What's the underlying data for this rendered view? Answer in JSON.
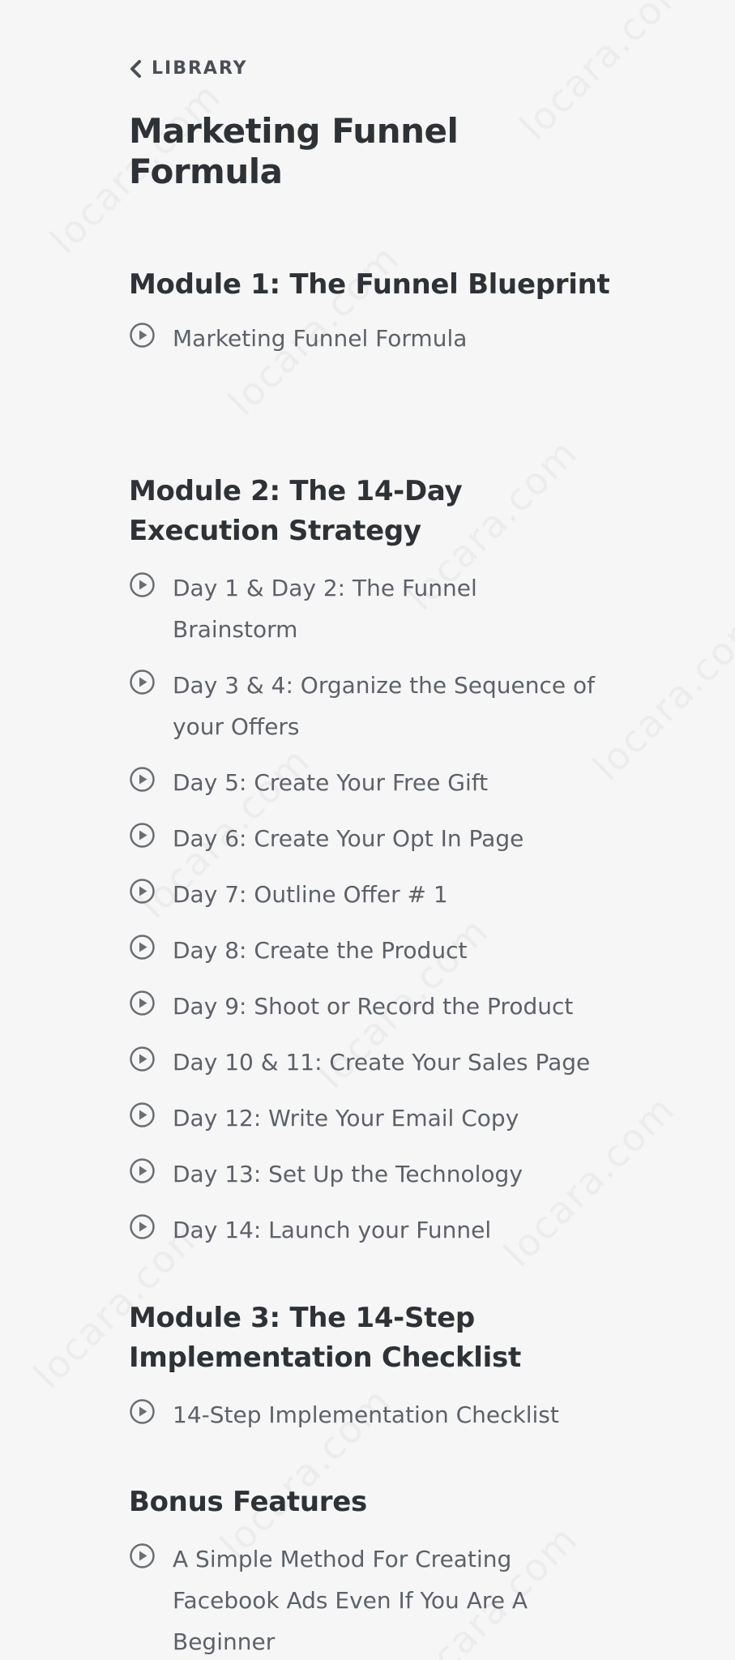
{
  "header": {
    "back_label": "LIBRARY",
    "title": "Marketing Funnel Formula"
  },
  "modules": [
    {
      "title": "Module 1: The Funnel Blueprint",
      "lessons": [
        "Marketing Funnel Formula"
      ]
    },
    {
      "title": "Module 2: The 14-Day Execution Strategy",
      "lessons": [
        "Day 1 & Day 2: The Funnel Brainstorm",
        "Day 3 & 4: Organize the Sequence of your Offers",
        "Day 5: Create Your Free Gift",
        "Day 6: Create Your Opt In Page",
        "Day 7: Outline Offer # 1",
        "Day 8: Create the Product",
        "Day 9: Shoot or Record the Product",
        "Day 10 & 11: Create Your Sales Page",
        "Day 12: Write Your Email Copy",
        "Day 13: Set Up the Technology",
        "Day 14: Launch your Funnel"
      ]
    },
    {
      "title": "Module 3: The 14-Step Implementation Checklist",
      "lessons": [
        "14-Step Implementation Checklist"
      ]
    },
    {
      "title": "Bonus Features",
      "lessons": [
        "A Simple Method For Creating Facebook Ads Even If You Are A Beginner"
      ]
    }
  ],
  "watermark": "locara.com",
  "icons": {
    "back": "chevron-left-icon",
    "lesson": "play-circle-icon"
  },
  "colors": {
    "background": "#f6f6f6",
    "heading": "#2e3236",
    "lesson_text": "#5d6168",
    "icon": "#6a6e74"
  }
}
